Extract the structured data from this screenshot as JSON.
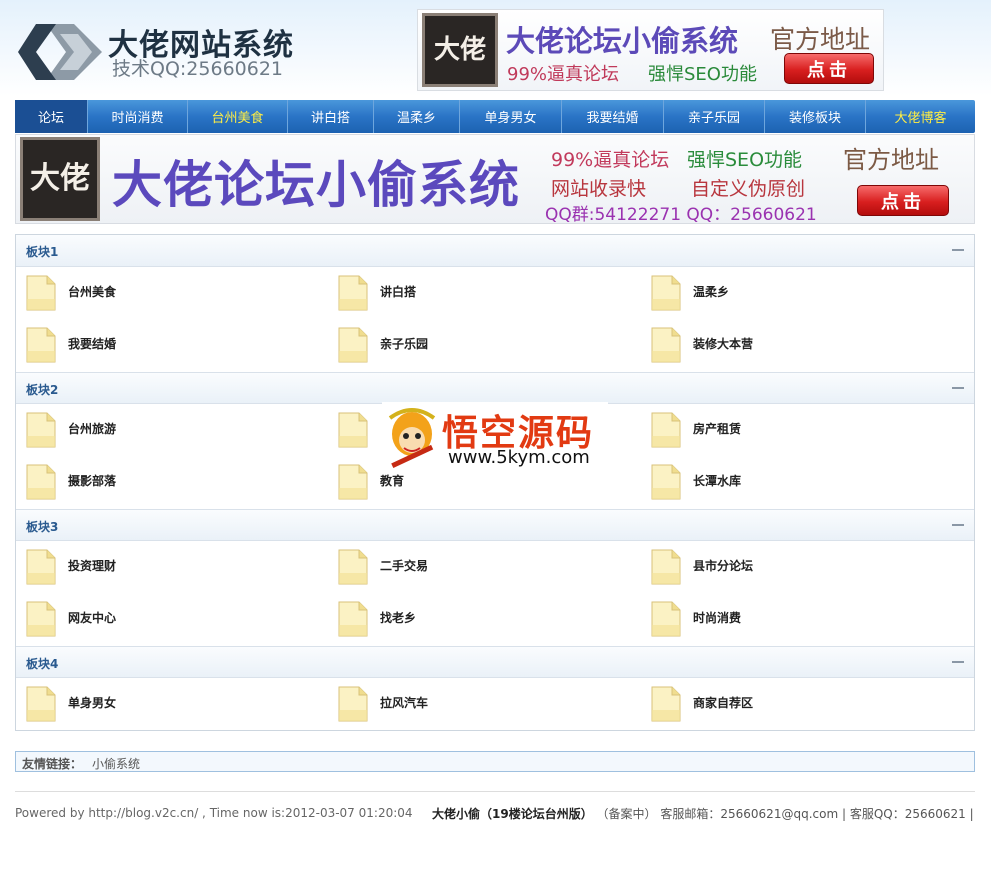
{
  "header": {
    "logo_title": "大佬网站系统",
    "logo_subtitle": "技术QQ:25660621",
    "ad": {
      "seal_text": "大佬",
      "title": "大佬论坛小偷系统",
      "address_label": "官方地址",
      "line1": "99%逼真论坛",
      "line2": "强悍SEO功能",
      "button": "点击"
    }
  },
  "nav": {
    "items": [
      {
        "label": "论坛",
        "active": true,
        "highlight": false
      },
      {
        "label": "时尚消费",
        "active": false,
        "highlight": false
      },
      {
        "label": "台州美食",
        "active": false,
        "highlight": true
      },
      {
        "label": "讲白搭",
        "active": false,
        "highlight": false
      },
      {
        "label": "温柔乡",
        "active": false,
        "highlight": false
      },
      {
        "label": "单身男女",
        "active": false,
        "highlight": false
      },
      {
        "label": "我要结婚",
        "active": false,
        "highlight": false
      },
      {
        "label": "亲子乐园",
        "active": false,
        "highlight": false
      },
      {
        "label": "装修板块",
        "active": false,
        "highlight": false
      },
      {
        "label": "大佬博客",
        "active": false,
        "highlight": true
      }
    ]
  },
  "banner": {
    "seal_text": "大佬",
    "title": "大佬论坛小偷系统",
    "line1": "99%逼真论坛",
    "line2": "强悍SEO功能",
    "address_label": "官方地址",
    "line3": "网站收录快",
    "line4": "自定义伪原创",
    "line5": "QQ群:54122271 QQ：25660621",
    "button": "点击"
  },
  "sections": [
    {
      "title": "板块1",
      "boards": [
        "台州美食",
        "讲白搭",
        "温柔乡",
        "我要结婚",
        "亲子乐园",
        "装修大本营"
      ]
    },
    {
      "title": "板块2",
      "boards": [
        "台州旅游",
        "",
        "房产租赁",
        "摄影部落",
        "教育",
        "长潭水库"
      ]
    },
    {
      "title": "板块3",
      "boards": [
        "投资理财",
        "二手交易",
        "县市分论坛",
        "网友中心",
        "找老乡",
        "时尚消费"
      ]
    },
    {
      "title": "板块4",
      "boards": [
        "单身男女",
        "拉风汽车",
        "商家自荐区"
      ]
    }
  ],
  "watermark": {
    "title": "悟空源码",
    "url": "www.5kym.com"
  },
  "friend_links": {
    "label": "友情链接：",
    "items": [
      "小偷系统"
    ]
  },
  "footer": {
    "powered": "Powered by http://blog.v2c.cn/ , Time now is:2012-03-07 01:20:04",
    "site_name": "大佬小偷（19楼论坛台州版）",
    "icp": "（备案中）",
    "email": "客服邮箱：25660621@qq.com",
    "sep": "|",
    "qq": "客服QQ：25660621",
    "sep2": "|"
  },
  "colors": {
    "nav_gradient_top": "#4a97db",
    "nav_gradient_bottom": "#1c62b1",
    "nav_highlight": "#ffee44",
    "section_title": "#2a5a8f",
    "button_red": "#d81f1f"
  }
}
